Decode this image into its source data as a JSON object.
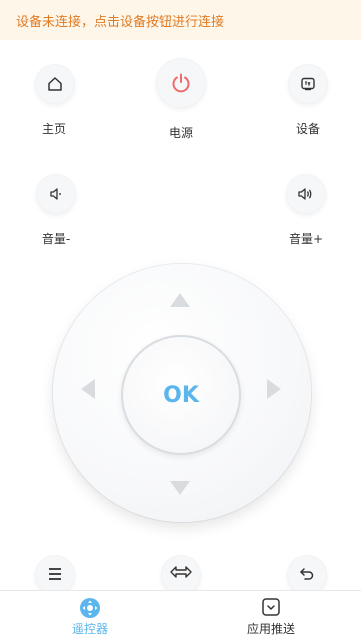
{
  "banner": {
    "text": "设备未连接，点击设备按钮进行连接"
  },
  "controls": {
    "home_label": "主页",
    "power_label": "电源",
    "device_label": "设备",
    "volume_down_label": "音量-",
    "volume_up_label": "音量+",
    "ok_label": "OK"
  },
  "icons": {
    "home": "home-icon",
    "power": "power-icon",
    "device": "tv-icon",
    "volume_down": "volume-down-icon",
    "volume_up": "volume-up-icon",
    "menu": "menu-icon",
    "switch": "switch-icon",
    "back": "back-icon"
  },
  "tabs": [
    {
      "label": "遥控器",
      "active": true
    },
    {
      "label": "应用推送",
      "active": false
    }
  ],
  "colors": {
    "accent": "#5ab6ec",
    "power": "#ef6b6b",
    "banner_bg": "#fdf6e9",
    "banner_text": "#e07b24"
  }
}
